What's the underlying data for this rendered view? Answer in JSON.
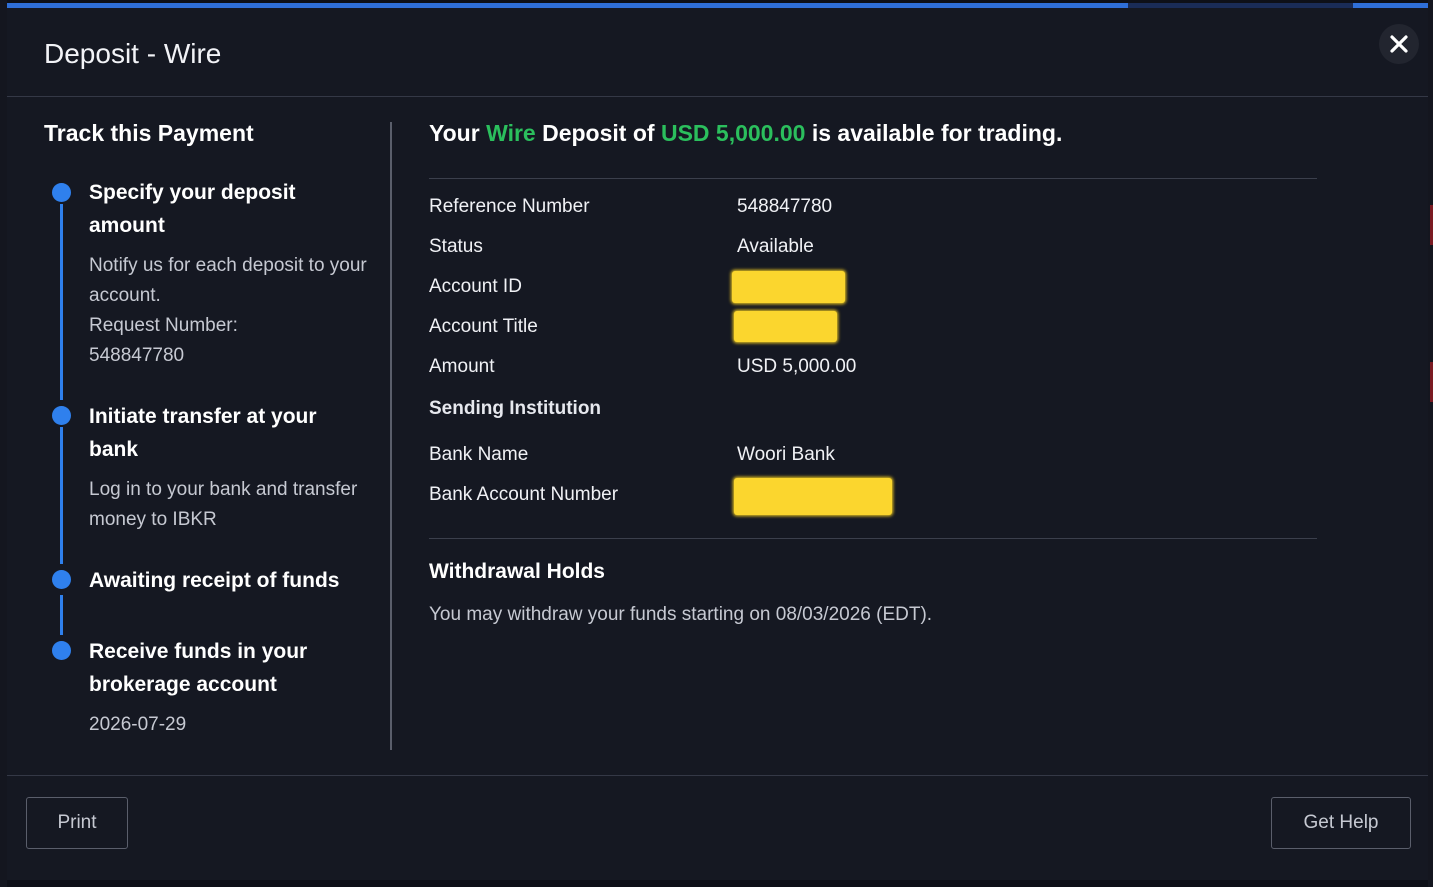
{
  "dialog": {
    "title": "Deposit - Wire",
    "close_icon": "close-icon"
  },
  "tracker": {
    "heading": "Track this Payment",
    "steps": [
      {
        "title": "Specify your deposit amount",
        "lines": [
          "Notify us for each deposit to your account.",
          "Request Number:",
          "548847780"
        ]
      },
      {
        "title": "Initiate transfer at your bank",
        "lines": [
          "Log in to your bank and transfer money to IBKR"
        ]
      },
      {
        "title": "Awaiting receipt of funds",
        "lines": []
      },
      {
        "title": "Receive funds in your brokerage account",
        "lines": [
          "2026-07-29"
        ]
      }
    ]
  },
  "details": {
    "headline_prefix": "Your",
    "headline_method": "Wire",
    "headline_mid": "Deposit of",
    "headline_amount": "USD 5,000.00",
    "headline_suffix": "is available for trading.",
    "rows": [
      {
        "label": "Reference Number",
        "value": "548847780"
      },
      {
        "label": "Status",
        "value": "Available"
      },
      {
        "label": "Account ID",
        "value": ""
      },
      {
        "label": "Account Title",
        "value": ""
      },
      {
        "label": "Amount",
        "value": "USD 5,000.00"
      }
    ],
    "sending_institution_heading": "Sending Institution",
    "bank_rows": [
      {
        "label": "Bank Name",
        "value": "Woori Bank"
      },
      {
        "label": "Bank Account Number",
        "value": ""
      }
    ]
  },
  "holds": {
    "title": "Withdrawal Holds",
    "text": "You may withdraw your funds starting on 08/03/2026 (EDT)."
  },
  "footer": {
    "print_label": "Print",
    "help_label": "Get Help"
  },
  "colors": {
    "accent": "#2f80ed",
    "highlight_green": "#2bbf5d",
    "redaction": "#fbd62e"
  }
}
